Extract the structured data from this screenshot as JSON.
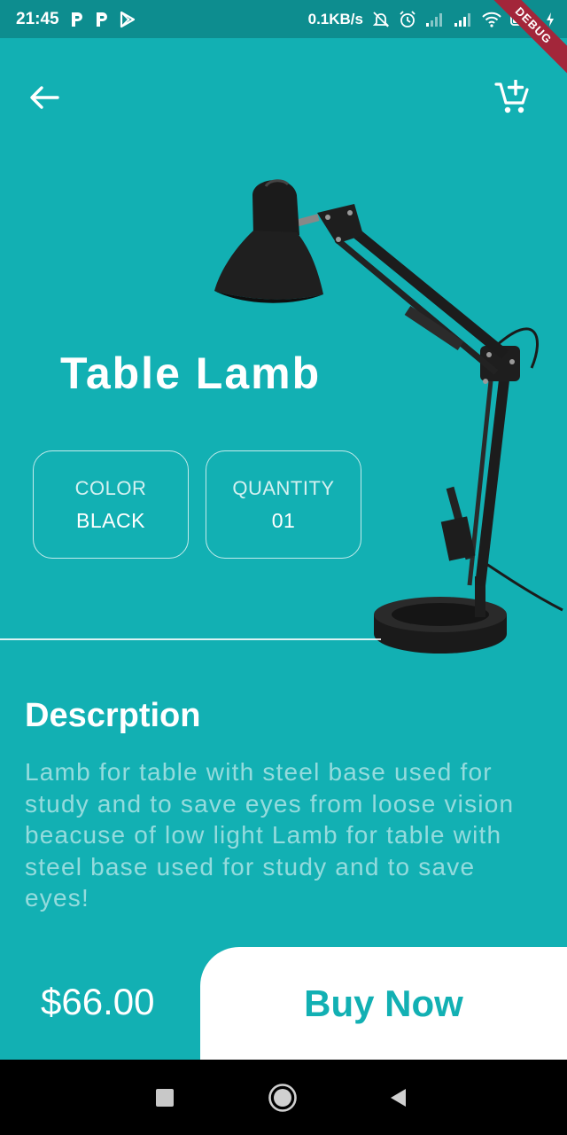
{
  "status_bar": {
    "time": "21:45",
    "network_speed": "0.1KB/s",
    "left_icons": [
      "p-icon",
      "p-icon",
      "play-store-icon"
    ],
    "right_icons": [
      "mute-icon",
      "alarm-icon",
      "signal-icon",
      "signal-icon",
      "wifi-icon",
      "battery-icon",
      "charging-icon"
    ],
    "debug_banner": "DEBUG"
  },
  "header": {
    "back_icon": "arrow-left-icon",
    "cart_icon": "add-to-cart-icon"
  },
  "product": {
    "title": "Table Lamb",
    "image_icon": "desk-lamp-image",
    "color_label": "COLOR",
    "color_value": "BLACK",
    "quantity_label": "QUANTITY",
    "quantity_value": "01"
  },
  "description": {
    "heading": "Descrption",
    "text": "Lamb for table with steel base used for study and to save eyes from loose vision beacuse of low light Lamb for table with steel base used for study and to save eyes!"
  },
  "footer": {
    "price": "$66.00",
    "buy_label": "Buy Now"
  },
  "navigation": {
    "buttons": [
      "recents-icon",
      "home-icon",
      "back-icon"
    ]
  },
  "colors": {
    "primary": "#12B0B3",
    "status_bar": "#0D8D8F",
    "buy_button_bg": "#FFFFFF",
    "debug_ribbon": "#A3263A"
  }
}
